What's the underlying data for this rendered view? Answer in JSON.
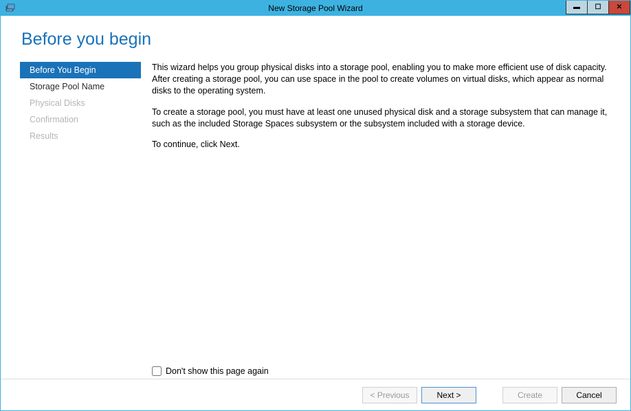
{
  "titlebar": {
    "title": "New Storage Pool Wizard"
  },
  "heading": "Before you begin",
  "sidebar": {
    "items": [
      {
        "label": "Before You Begin",
        "state": "active"
      },
      {
        "label": "Storage Pool Name",
        "state": "enabled"
      },
      {
        "label": "Physical Disks",
        "state": "disabled"
      },
      {
        "label": "Confirmation",
        "state": "disabled"
      },
      {
        "label": "Results",
        "state": "disabled"
      }
    ]
  },
  "main": {
    "para1": "This wizard helps you group physical disks into a storage pool, enabling you to make more efficient use of disk capacity. After creating a storage pool, you can use space in the pool to create volumes on virtual disks, which appear as normal disks to the operating system.",
    "para2": "To create a storage pool, you must have at least one unused physical disk and a storage subsystem that can manage it, such as the included Storage Spaces subsystem or the subsystem included with a storage device.",
    "para3": "To continue, click Next.",
    "checkbox_label": "Don't show this page again"
  },
  "footer": {
    "previous": "< Previous",
    "next": "Next >",
    "create": "Create",
    "cancel": "Cancel"
  }
}
